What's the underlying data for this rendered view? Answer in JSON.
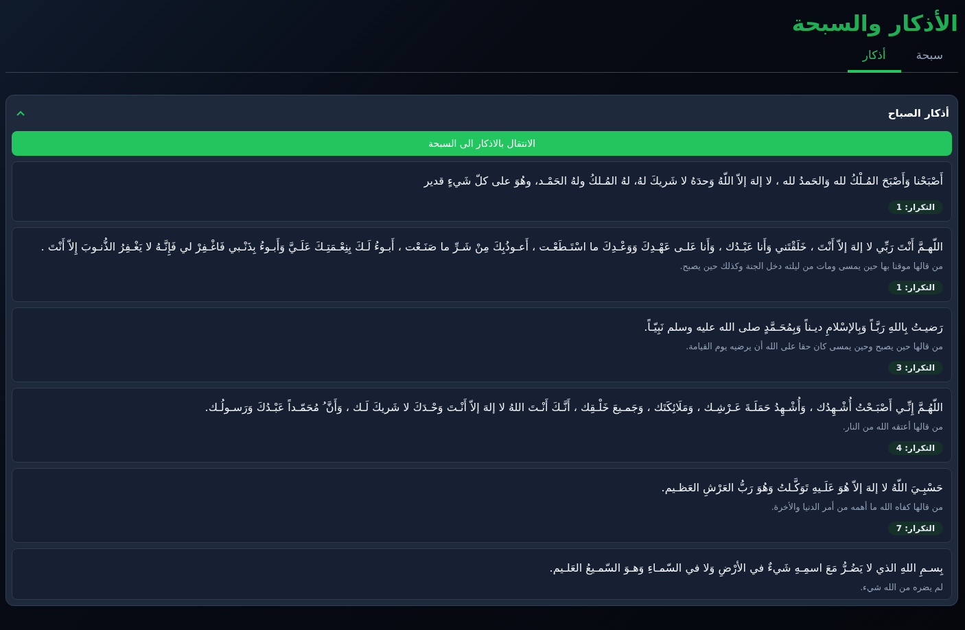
{
  "header": {
    "title": "الأذكار والسبحة"
  },
  "tabs": [
    {
      "label": "سبحة",
      "selected": false
    },
    {
      "label": "أذكار",
      "selected": true
    }
  ],
  "section": {
    "title": "أذكار الصباح",
    "expanded": true,
    "action": "الانتقال بالاذكار الى السبحة",
    "items": [
      {
        "text": "أَصْبَحْنا وَأَصْبَحَ المُـلْكُ لله وَالحَمدُ لله ، لا إلهَ إلاّ اللّهُ وَحدَهُ لا شَريكَ لهُ، لهُ المُـلكُ ولهُ الحَمْـد، وهُوَ على كلّ شَيءٍ قدير",
        "repeat": "التكرار: 1"
      },
      {
        "text": "اللّهـمَّ أَنْتَ رَبِّي لا إلهَ إلاّ أَنْتَ ، خَلَقْتَني وَأَنا عَبْـدُك ، وَأَنا عَلـى عَهْـدِكَ وَوَعْـدِكَ ما اسْتَـطَعْـت ، أَعـوذُبِكَ مِنْ شَـرِّ ما صَنَـعْت ، أَبـوءُ لَـكَ بِنِعْـمَتِـكَ عَلَـيَّ وَأَبـوءُ بِذَنْـبي فَاغْـفِرْ لي فَإِنَّـهُ لا يَغْـفِرُ الذُّنـوبَ إِلاّ أَنْتَ .",
        "note": "من قالها موقنا بها حين يمسى ومات من ليلته دخل الجنة وكذلك حين يصبح.",
        "repeat": "التكرار: 1"
      },
      {
        "text": "رَضيـتُ بِاللهِ رَبَّـاً وَبِالإسْلامِ ديـناً وَبِمُحَـمَّدٍ صلى الله عليه وسلم نَبِيّـاً.",
        "note": "من قالها حين يصبح وحين يمسى كان حقا على الله أن يرضيه يوم القيامة.",
        "repeat": "التكرار: 3"
      },
      {
        "text": "اللّهُـمَّ إِنِّـي أَصْبَـحْتُ أُشْـهِدُك ، وَأُشْـهِدُ حَمَلَـةَ عَـرْشِـك ، وَمَلَائِكَتَك ، وَجَمـيعَ خَلْـقِك ، أَنَّـكَ أَنْـتَ اللهُ لا إلهَ إلاّ أَنْـتَ وَحْـدَكَ لا شَريكَ لَـك ، وَأَنَّ ُ مُحَمّـداً عَبْـدُكَ وَرَسـولُـك.",
        "note": "من قالها أعتقه الله من النار.",
        "repeat": "التكرار: 4"
      },
      {
        "text": "حَسْبِـيَ اللّهُ لا إلهَ إلاّ هُوَ عَلَـيهِ تَوَكَّـلتُ وَهُوَ رَبُّ العَرْشِ العَظـيم.",
        "note": "من قالها كفاه الله ما أهمه من أمر الدنيا والأخرة.",
        "repeat": "التكرار: 7"
      },
      {
        "text": "بِسـمِ اللهِ الذي لا يَضُـرُّ مَعَ اسمِـهِ شَيءٌ في الأرْضِ وَلا في السّمـاءِ وَهـوَ السّمـيعُ العَلـيم.",
        "note": "لم يضره من الله شيء."
      }
    ]
  }
}
